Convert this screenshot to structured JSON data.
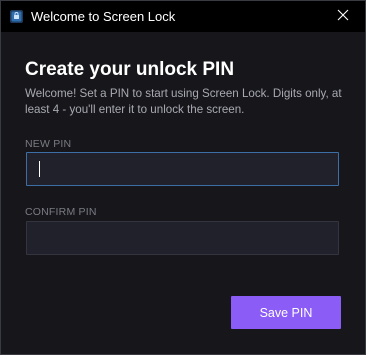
{
  "window": {
    "title": "Welcome to Screen Lock",
    "app_icon": "lock-app-icon",
    "close_icon": "close-icon"
  },
  "main": {
    "heading": "Create your unlock PIN",
    "description": "Welcome! Set a PIN to start using Screen Lock. Digits only, at least 4 - you'll enter it to unlock the screen."
  },
  "form": {
    "new_pin": {
      "label": "NEW PIN",
      "value": ""
    },
    "confirm_pin": {
      "label": "CONFIRM PIN",
      "value": ""
    },
    "save_label": "Save PIN"
  },
  "colors": {
    "background": "#16161b",
    "titlebar": "#000000",
    "accent": "#8b5cf6",
    "focus_border": "#3d6fa6",
    "input_bg": "#20212b"
  }
}
